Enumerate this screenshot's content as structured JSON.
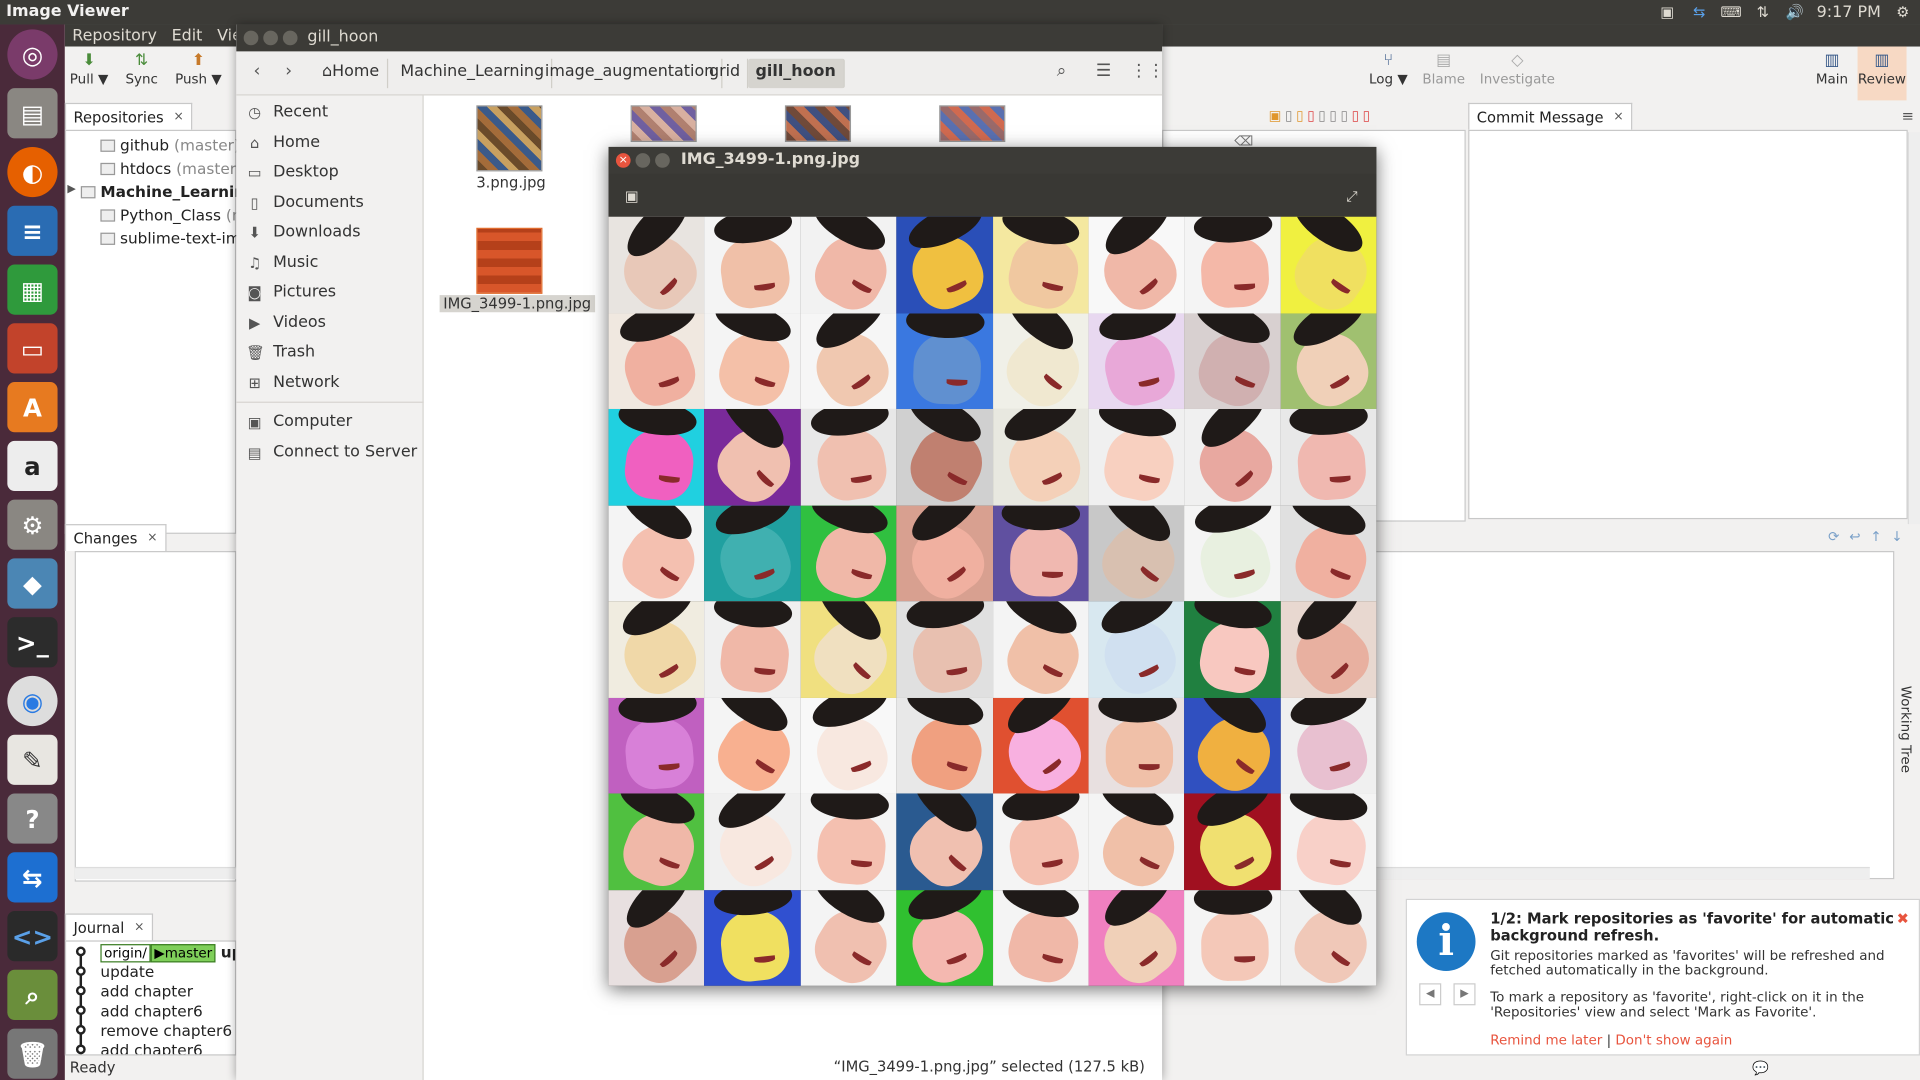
{
  "topbar": {
    "app_title": "Image Viewer",
    "clock": "9:17 PM"
  },
  "launcher": {
    "items": [
      "ubuntu-logo-icon",
      "files-icon",
      "firefox-icon",
      "writer-icon",
      "calc-icon",
      "impress-icon",
      "software-center-icon",
      "amazon-icon",
      "settings-icon",
      "python-icon",
      "terminal-icon",
      "chrome-icon",
      "text-editor-icon",
      "help-icon",
      "teamviewer-icon",
      "code-icon",
      "image-viewer-icon",
      "trash-icon"
    ]
  },
  "smartgit": {
    "menu": [
      "Repository",
      "Edit",
      "View"
    ],
    "toolbar_left": [
      {
        "label": "Pull ▼",
        "icon": "pull-icon"
      },
      {
        "label": "Sync",
        "icon": "sync-icon"
      },
      {
        "label": "Push ▼",
        "icon": "push-icon"
      }
    ],
    "toolbar_right": [
      {
        "label": "Log ▼",
        "icon": "log-icon"
      },
      {
        "label": "Blame",
        "icon": "blame-icon"
      },
      {
        "label": "Investigate",
        "icon": "investigate-icon"
      },
      {
        "label": "Main",
        "icon": "main-layout-icon"
      },
      {
        "label": "Review",
        "icon": "review-layout-icon"
      }
    ],
    "repositories_tab": "Repositories",
    "repositories": [
      {
        "name": "github",
        "branch": "(master)"
      },
      {
        "name": "htdocs",
        "branch": "(master)"
      },
      {
        "name": "Machine_Learning",
        "branch": "("
      },
      {
        "name": "Python_Class",
        "branch": "(maste"
      },
      {
        "name": "sublime-text-imfix",
        "branch": "(r"
      }
    ],
    "changes_tab": "Changes",
    "commit_tab": "Commit Message",
    "working_tree": "Working Tree",
    "journal_tab": "Journal",
    "journal": {
      "head_tags": [
        "origin/",
        "master"
      ],
      "head_msg": "upd",
      "entries": [
        "update",
        "add chapter",
        "add chapter6",
        "remove chapter6",
        "add chapter6"
      ]
    },
    "status": "Ready"
  },
  "notification": {
    "title": "1/2: Mark repositories as 'favorite' for automatic background refresh.",
    "body1": "Git repositories marked as 'favorites' will be refreshed and fetched automatically in the background.",
    "body2": "To mark a repository as 'favorite', right-click on it in the 'Repositories' view and select 'Mark as Favorite'.",
    "remind": "Remind me later",
    "sep": "|",
    "dont_show": "Don't show again"
  },
  "file_manager": {
    "title": "gill_hoon",
    "breadcrumbs": [
      "Home",
      "Machine_Learning",
      "image_augmentation",
      "grid",
      "gill_hoon"
    ],
    "sidebar": [
      {
        "label": "Recent",
        "icon": "clock-icon"
      },
      {
        "label": "Home",
        "icon": "home-icon"
      },
      {
        "label": "Desktop",
        "icon": "folder-icon"
      },
      {
        "label": "Documents",
        "icon": "document-icon"
      },
      {
        "label": "Downloads",
        "icon": "download-icon"
      },
      {
        "label": "Music",
        "icon": "music-icon"
      },
      {
        "label": "Pictures",
        "icon": "camera-icon"
      },
      {
        "label": "Videos",
        "icon": "video-icon"
      },
      {
        "label": "Trash",
        "icon": "trash-icon"
      },
      {
        "label": "Network",
        "icon": "network-icon"
      },
      {
        "label": "Computer",
        "icon": "computer-icon"
      },
      {
        "label": "Connect to Server",
        "icon": "server-icon"
      }
    ],
    "files": [
      {
        "name": "3.png.jpg"
      },
      {
        "name": ""
      },
      {
        "name": ""
      },
      {
        "name": ""
      },
      {
        "name": "IMG_3499-1.png.jpg",
        "selected": true
      }
    ],
    "status": "“IMG_3499-1.png.jpg” selected  (127.5 kB)"
  },
  "image_viewer": {
    "title": "IMG_3499-1.png.jpg",
    "grid_rows": 8,
    "grid_cols": 8
  }
}
